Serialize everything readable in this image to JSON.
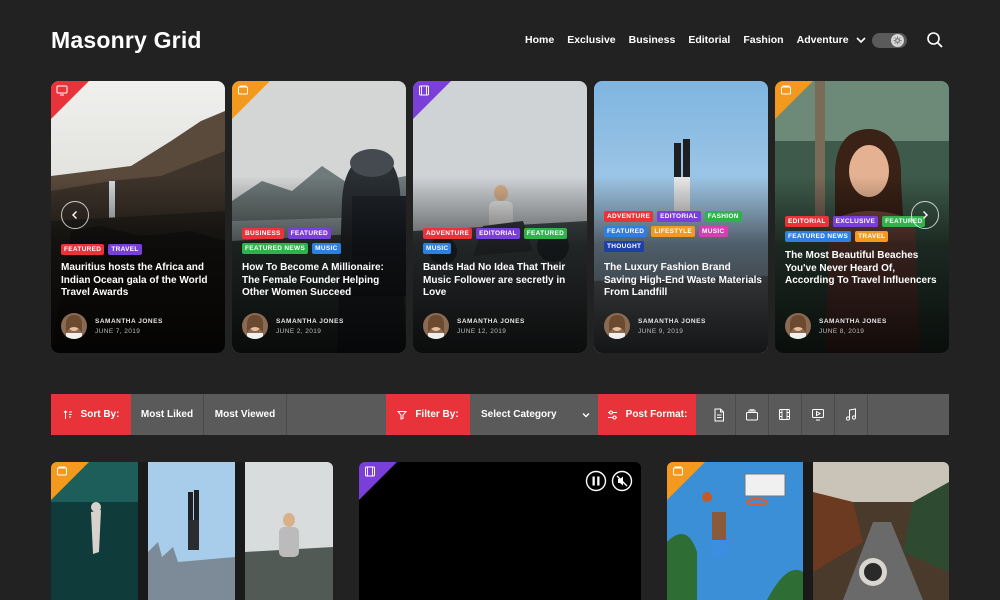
{
  "header": {
    "logo": "Masonry Grid",
    "nav": [
      "Home",
      "Exclusive",
      "Business",
      "Editorial",
      "Fashion",
      "Adventure"
    ]
  },
  "hero": {
    "cards": [
      {
        "format": "gallery",
        "corner_color": "#e9333a",
        "tags": [
          {
            "label": "FEATURED",
            "color": "#e9333a"
          },
          {
            "label": "TRAVEL",
            "color": "#7b3fd9"
          }
        ],
        "title": "Mauritius hosts the Africa and Indian Ocean gala of the World Travel Awards",
        "author": "SAMANTHA JONES",
        "date": "JUNE 7, 2019"
      },
      {
        "format": "standard",
        "corner_color": "#f39a1e",
        "tags": [
          {
            "label": "BUSINESS",
            "color": "#e9333a"
          },
          {
            "label": "FEATURED",
            "color": "#7b3fd9"
          },
          {
            "label": "FEATURED NEWS",
            "color": "#2fb24c"
          },
          {
            "label": "MUSIC",
            "color": "#2d7fe0"
          }
        ],
        "title": "How To Become A Millionaire: The Female Founder Helping Other Women Succeed",
        "author": "SAMANTHA JONES",
        "date": "JUNE 2, 2019"
      },
      {
        "format": "video",
        "corner_color": "#7b3fd9",
        "tags": [
          {
            "label": "ADVENTURE",
            "color": "#e9333a"
          },
          {
            "label": "EDITORIAL",
            "color": "#7b3fd9"
          },
          {
            "label": "FEATURED",
            "color": "#2fb24c"
          },
          {
            "label": "MUSIC",
            "color": "#2d7fe0"
          }
        ],
        "title": "Bands Had No Idea That Their Music Follower are secretly in Love",
        "author": "SAMANTHA JONES",
        "date": "JUNE 12, 2019"
      },
      {
        "format": "standard",
        "corner_color": "#f39a1e",
        "tags": [
          {
            "label": "ADVENTURE",
            "color": "#e9333a"
          },
          {
            "label": "EDITORIAL",
            "color": "#7b3fd9"
          },
          {
            "label": "FASHION",
            "color": "#2fb24c"
          },
          {
            "label": "FEATURED",
            "color": "#2d7fe0"
          },
          {
            "label": "LIFESTYLE",
            "color": "#f39a1e"
          },
          {
            "label": "MUSIC",
            "color": "#d63fb3"
          },
          {
            "label": "THOUGHT",
            "color": "#1f3fa8"
          }
        ],
        "title": "The Luxury Fashion Brand Saving High-End Waste Materials From Landfill",
        "author": "SAMANTHA JONES",
        "date": "JUNE 9, 2019"
      },
      {
        "format": "standard",
        "corner_color": "#f39a1e",
        "tags": [
          {
            "label": "EDITORIAL",
            "color": "#e9333a"
          },
          {
            "label": "EXCLUSIVE",
            "color": "#7b3fd9"
          },
          {
            "label": "FEATURED",
            "color": "#2fb24c"
          },
          {
            "label": "FEATURED NEWS",
            "color": "#2d7fe0"
          },
          {
            "label": "TRAVEL",
            "color": "#f39a1e"
          }
        ],
        "title": "The Most Beautiful Beaches You've Never Heard Of, According To Travel Influencers",
        "author": "SAMANTHA JONES",
        "date": "JUNE 8, 2019"
      }
    ]
  },
  "filter_bar": {
    "sort_label": "Sort By:",
    "sort_options": [
      "Most Liked",
      "Most Viewed"
    ],
    "filter_label": "Filter By:",
    "filter_value": "Select Category",
    "format_label": "Post Format:",
    "formats": [
      "standard-icon",
      "gallery-icon",
      "video-icon",
      "slideshow-icon",
      "audio-icon"
    ]
  },
  "colors": {
    "accent": "#e9333a",
    "background": "#222222",
    "bar": "#5a5a5a"
  }
}
